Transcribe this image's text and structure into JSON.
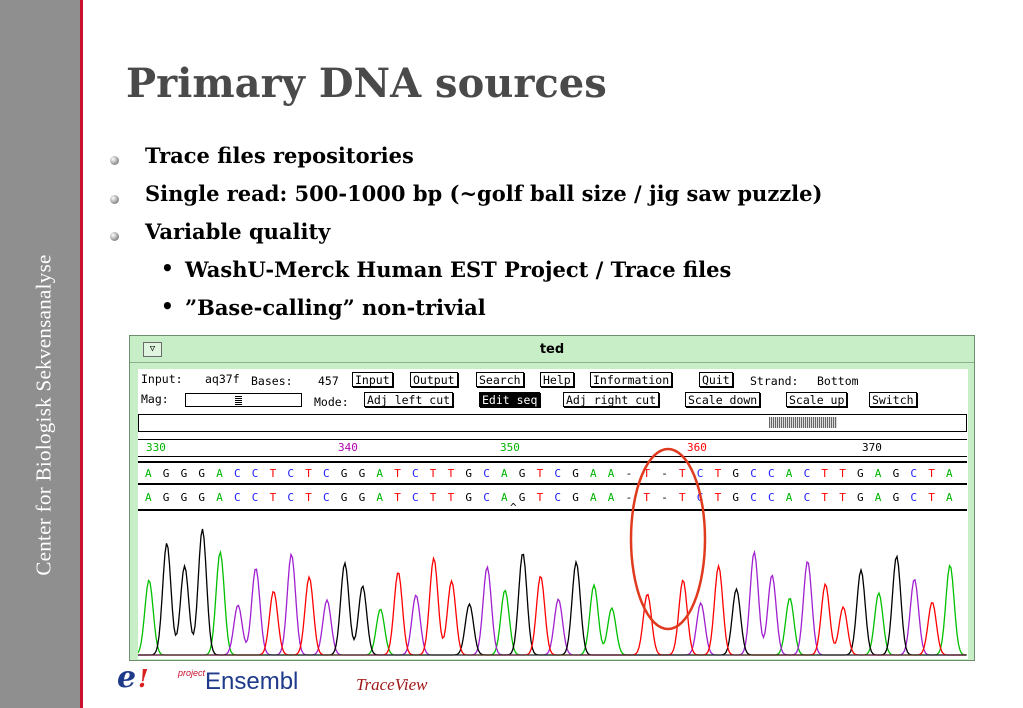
{
  "sidebar": {
    "text": "Center for Biologisk Sekvensanalyse"
  },
  "slide": {
    "title": "Primary DNA sources",
    "bullets": [
      "Trace files repositories",
      "Single read: 500-1000 bp (~golf ball size / jig saw puzzle)",
      "Variable quality"
    ],
    "subbullets": [
      "WashU-Merck Human EST Project / Trace files",
      "”Base-calling” non-trivial"
    ],
    "subbullet_marker": "•"
  },
  "ted": {
    "title": "ted",
    "minimize_glyph": "▽",
    "input_label": "Input:",
    "input_value": "aq37f",
    "bases_label": "Bases:",
    "bases_value": "457",
    "mag_label": "Mag:",
    "mode_label": "Mode:",
    "strand_label": "Strand:",
    "strand_value": "Bottom",
    "buttons_row1": [
      "Input",
      "Output",
      "Search",
      "Help",
      "Information",
      "Quit"
    ],
    "buttons_row2": [
      "Adj left cut",
      "Edit seq",
      "Adj right cut",
      "Scale down",
      "Scale up",
      "Switch"
    ],
    "active_mode": "Edit seq",
    "positions": [
      "330",
      "340",
      "350",
      "360",
      "370"
    ],
    "base_colors": {
      "A": "#00b400",
      "C": "#2020ff",
      "G": "#000000",
      "T": "#ff0000",
      "-": "#000000"
    },
    "sequence_1": [
      "A",
      "G",
      "G",
      "G",
      "A",
      "C",
      "C",
      "T",
      "C",
      "T",
      "C",
      "G",
      "G",
      "A",
      "T",
      "C",
      "T",
      "T",
      "G",
      "C",
      "A",
      "G",
      "T",
      "C",
      "G",
      "A",
      "A",
      "-",
      "T",
      "-",
      "T",
      "C",
      "T",
      "G",
      "C",
      "C",
      "A",
      "C",
      "T",
      "T",
      "G",
      "A",
      "G",
      "C",
      "T",
      "A"
    ],
    "sequence_2": [
      "A",
      "G",
      "G",
      "G",
      "A",
      "C",
      "C",
      "T",
      "C",
      "T",
      "C",
      "G",
      "G",
      "A",
      "T",
      "C",
      "T",
      "T",
      "G",
      "C",
      "A",
      "G",
      "T",
      "C",
      "G",
      "A",
      "A",
      "-",
      "T",
      "-",
      "T",
      "C",
      "T",
      "G",
      "C",
      "C",
      "A",
      "C",
      "T",
      "T",
      "G",
      "A",
      "G",
      "C",
      "T",
      "A"
    ],
    "caret": "^",
    "highlight_color": "#e03a1e"
  },
  "footer": {
    "logo_e": "e",
    "logo_bang": "!",
    "logo_project": "project",
    "logo_name": "Ensembl",
    "traceview": "TraceView"
  }
}
